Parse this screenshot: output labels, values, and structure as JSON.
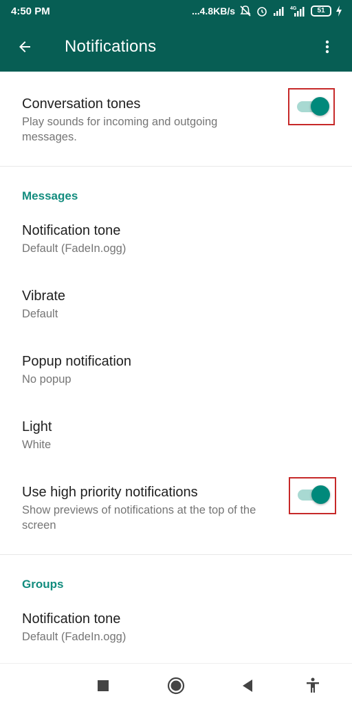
{
  "status_bar": {
    "time": "4:50 PM",
    "network_speed": "...4.8KB/s",
    "battery_level": "51",
    "icons": [
      "mute-icon",
      "alarm-icon",
      "signal-icon",
      "4g-signal-icon",
      "battery-icon",
      "charging-icon"
    ]
  },
  "app_bar": {
    "back_icon": "arrow-back-icon",
    "title": "Notifications",
    "more_icon": "more-vert-icon",
    "background": "#075e54"
  },
  "conversation_tones": {
    "title": "Conversation tones",
    "subtitle": "Play sounds for incoming and outgoing messages.",
    "enabled": true
  },
  "messages_section": {
    "header": "Messages",
    "items": [
      {
        "title": "Notification tone",
        "value": "Default (FadeIn.ogg)"
      },
      {
        "title": "Vibrate",
        "value": "Default"
      },
      {
        "title": "Popup notification",
        "value": "No popup"
      },
      {
        "title": "Light",
        "value": "White"
      }
    ],
    "high_priority": {
      "title": "Use high priority notifications",
      "subtitle": "Show previews of notifications at the top of the screen",
      "enabled": true
    }
  },
  "groups_section": {
    "header": "Groups",
    "items": [
      {
        "title": "Notification tone",
        "value": "Default (FadeIn.ogg)"
      }
    ]
  },
  "nav_bar": {
    "icons": [
      "recents-square-icon",
      "home-circle-icon",
      "back-triangle-icon",
      "accessibility-icon"
    ]
  },
  "colors": {
    "accent": "#128c7e",
    "toggle_on": "#00897b",
    "highlight_box": "#c62828"
  }
}
